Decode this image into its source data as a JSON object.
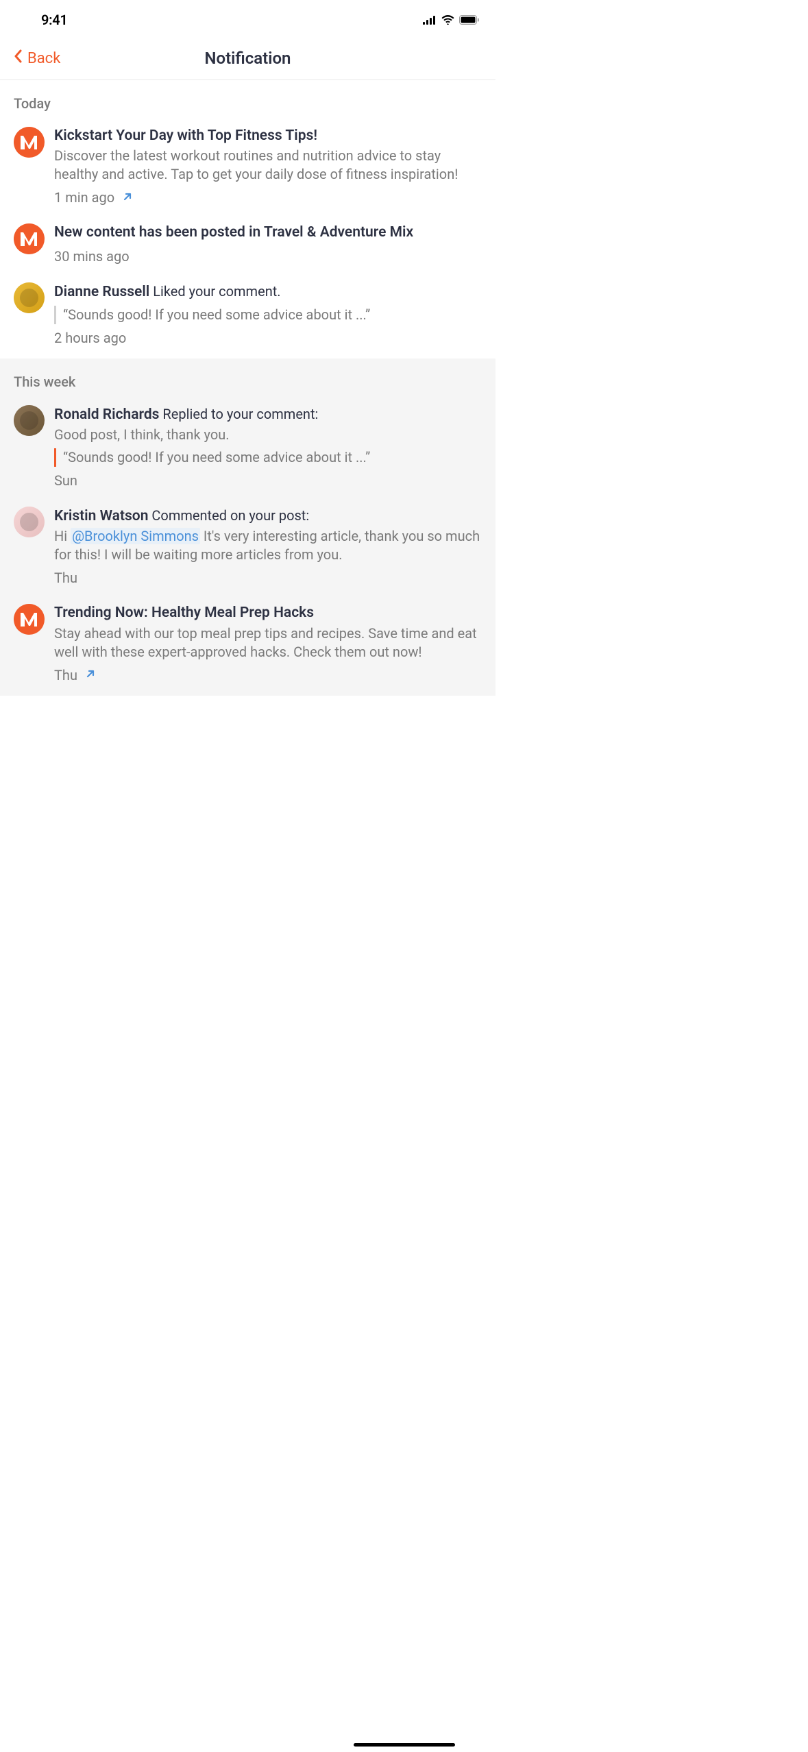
{
  "status": {
    "time": "9:41"
  },
  "nav": {
    "back_label": "Back",
    "title": "Notification"
  },
  "sections": [
    {
      "header": "Today",
      "gray": false,
      "items": [
        {
          "avatar_type": "m",
          "title": "Kickstart Your Day with Top Fitness Tips!",
          "body": "Discover the latest workout routines and nutrition advice to stay healthy and active. Tap to get your daily dose of fitness inspiration!",
          "time": "1 min ago",
          "has_link_arrow": true
        },
        {
          "avatar_type": "m",
          "title_parts": [
            {
              "text": "New content has been posted in Travel & Adventure Mix",
              "bold": true
            }
          ],
          "time": "30 mins ago"
        },
        {
          "avatar_type": "photo",
          "avatar_class": "avatar-dianne",
          "title_parts": [
            {
              "text": "Dianne Russell",
              "bold": true
            },
            {
              "text": " Liked your comment.",
              "bold": false
            }
          ],
          "quote": "“Sounds good! If you need some advice about it ...”",
          "quote_style": "gray",
          "time": "2 hours ago"
        }
      ]
    },
    {
      "header": "This week",
      "gray": true,
      "items": [
        {
          "avatar_type": "photo",
          "avatar_class": "avatar-ronald",
          "title_parts": [
            {
              "text": "Ronald Richards",
              "bold": true
            },
            {
              "text": " Replied to your comment:",
              "bold": false
            }
          ],
          "body": "Good post, I think, thank you.",
          "quote": "“Sounds good! If you need some advice about it ...”",
          "quote_style": "orange",
          "time": "Sun"
        },
        {
          "avatar_type": "photo",
          "avatar_class": "avatar-kristin",
          "title_parts": [
            {
              "text": "Kristin Watson",
              "bold": true
            },
            {
              "text": " Commented on your post:",
              "bold": false
            }
          ],
          "body_parts": [
            {
              "text": "Hi "
            },
            {
              "text": "@Brooklyn Simmons",
              "mention": true
            },
            {
              "text": " It's very interesting article, thank you so much for this! I will be waiting more articles from you."
            }
          ],
          "time": "Thu"
        },
        {
          "avatar_type": "m",
          "title": "Trending Now: Healthy Meal Prep Hacks",
          "body": "Stay ahead with our top meal prep tips and recipes. Save time and eat well with these expert-approved hacks. Check them out now!",
          "time": "Thu",
          "has_link_arrow": true
        }
      ]
    }
  ]
}
